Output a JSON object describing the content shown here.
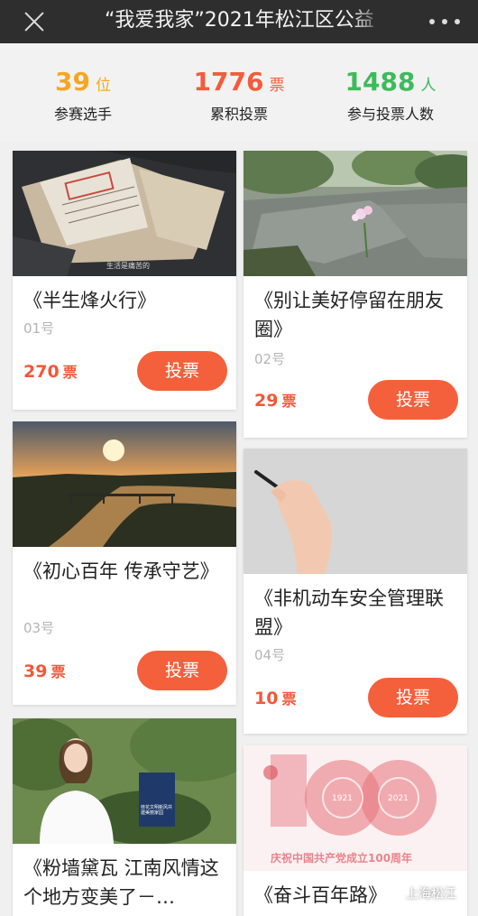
{
  "header": {
    "title": "“我爱我家”2021年松江区公益"
  },
  "stats": [
    {
      "number": "39",
      "unit": "位",
      "label": "参赛选手",
      "color": "#f5a623"
    },
    {
      "number": "1776",
      "unit": "票",
      "label": "累积投票",
      "color": "#f25c3c"
    },
    {
      "number": "1488",
      "unit": "人",
      "label": "参与投票人数",
      "color": "#3dbb5b"
    }
  ],
  "cards": [
    {
      "title": "《半生烽火行》",
      "number": "01号",
      "votes": "270",
      "vote_unit": "票",
      "button": "投票",
      "thumb_caption": "生活是痛苦的"
    },
    {
      "title": "《别让美好停留在朋友圈》",
      "number": "02号",
      "votes": "29",
      "vote_unit": "票",
      "button": "投票"
    },
    {
      "title": "《初心百年 传承守艺》",
      "number": "03号",
      "votes": "39",
      "vote_unit": "票",
      "button": "投票"
    },
    {
      "title": "《非机动车安全管理联盟》",
      "number": "04号",
      "votes": "10",
      "vote_unit": "票",
      "button": "投票"
    },
    {
      "title": "《粉墙黛瓦 江南风情这个地方变美了－…",
      "thumb_text": "桂花文明新风共建美丽家园"
    },
    {
      "title": "《奋斗百年路》",
      "thumb_text_1": "1921",
      "thumb_text_2": "2021",
      "thumb_text_3": "100",
      "thumb_banner": "庆祝中国共产党成立100周年"
    }
  ],
  "watermark": "上海松江",
  "colors": {
    "accent": "#f4603c",
    "vote_text": "#f3573a"
  }
}
